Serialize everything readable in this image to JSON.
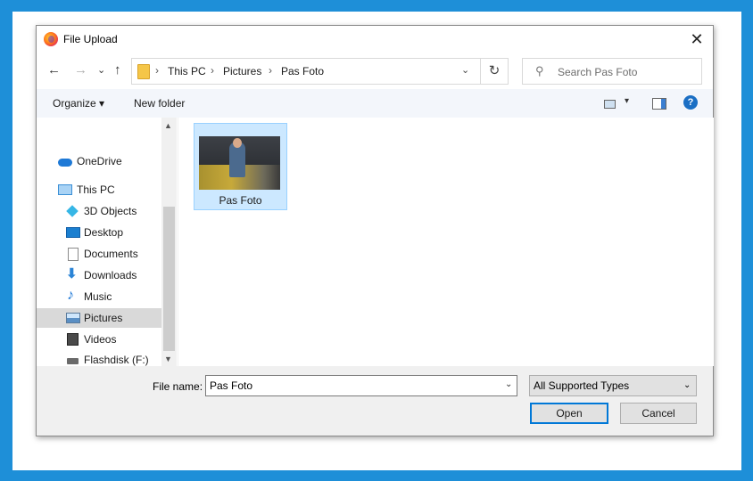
{
  "window": {
    "title": "File Upload",
    "close_glyph": "✕",
    "icon": "firefox-icon"
  },
  "nav": {
    "back_glyph": "←",
    "forward_glyph": "→",
    "recent_glyph": "⌄",
    "up_glyph": "↑"
  },
  "address": {
    "breadcrumbs": [
      "This PC",
      "Pictures",
      "Pas Foto"
    ],
    "separator": "›",
    "dropdown_glyph": "⌄",
    "refresh_glyph": "↻"
  },
  "search": {
    "placeholder": "Search Pas Foto",
    "icon_glyph": "⚲"
  },
  "toolbar": {
    "organize_label": "Organize ▾",
    "new_folder_label": "New folder",
    "view_dropdown_glyph": "▾",
    "help_glyph": "?"
  },
  "sidebar": {
    "items": [
      {
        "label": "OneDrive",
        "icon": "onedrive-icon",
        "color": "#1e79d6"
      },
      {
        "label": "This PC",
        "icon": "pc-icon",
        "color": "#3a8fd6"
      },
      {
        "label": "3D Objects",
        "icon": "cube-icon",
        "color": "#36b6e6"
      },
      {
        "label": "Desktop",
        "icon": "desktop-icon",
        "color": "#1b7fd0"
      },
      {
        "label": "Documents",
        "icon": "document-icon",
        "color": "#8a8a8a"
      },
      {
        "label": "Downloads",
        "icon": "download-icon",
        "color": "#2b84d6"
      },
      {
        "label": "Music",
        "icon": "music-icon",
        "color": "#1e79d6"
      },
      {
        "label": "Pictures",
        "icon": "picture-icon",
        "color": "#5a8fc4"
      },
      {
        "label": "Videos",
        "icon": "video-icon",
        "color": "#4a4a4a"
      },
      {
        "label": "Flashdisk (F:)",
        "icon": "drive-icon",
        "color": "#6a6a6a"
      }
    ],
    "selected": "Pictures",
    "scroll_up_glyph": "▲",
    "scroll_down_glyph": "▼"
  },
  "files": [
    {
      "name": "Pas Foto",
      "type": "image"
    }
  ],
  "footer": {
    "file_name_label": "File name:",
    "file_name_value": "Pas Foto",
    "file_type_value": "All Supported Types",
    "dropdown_glyph": "⌄",
    "open_label": "Open",
    "cancel_label": "Cancel"
  },
  "colors": {
    "accent": "#0078d7",
    "selection": "#cce8ff",
    "background": "#1e8fd8"
  }
}
